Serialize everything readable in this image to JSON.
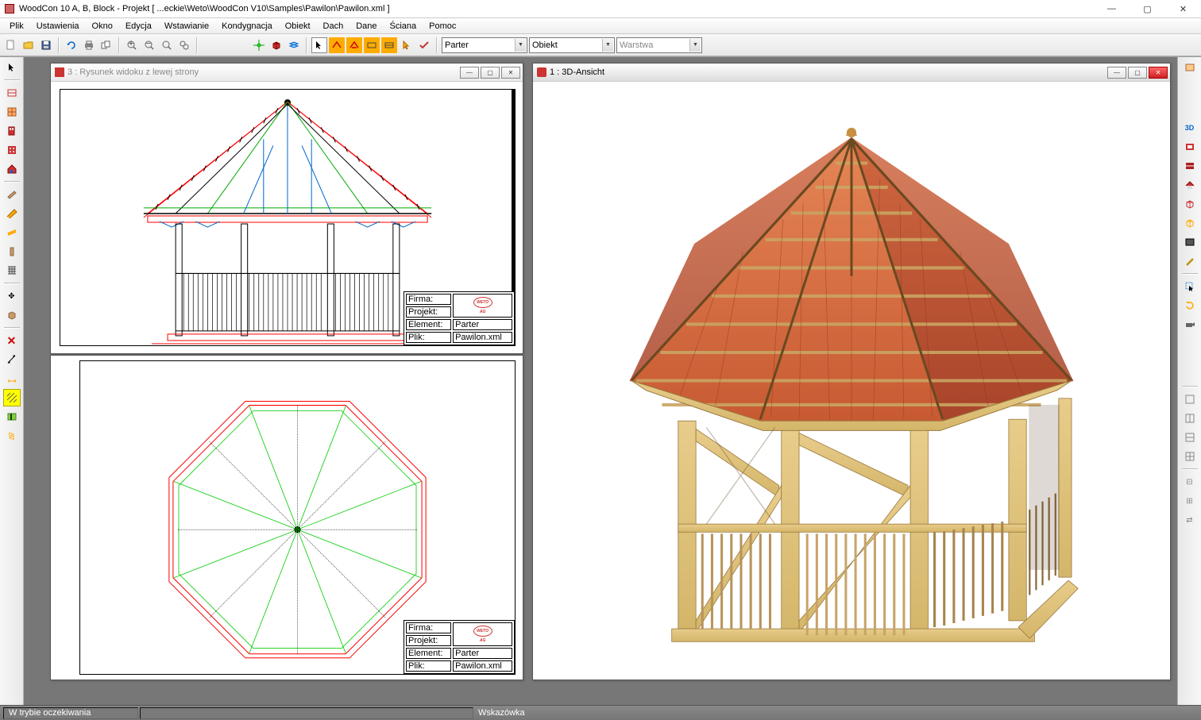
{
  "title": "WoodCon 10 A, B, Block - Projekt [ ...eckie\\Weto\\WoodCon V10\\Samples\\Pawilon\\Pawilon.xml ]",
  "menu": {
    "items": [
      "Plik",
      "Ustawienia",
      "Okno",
      "Edycja",
      "Wstawianie",
      "Kondygnacja",
      "Obiekt",
      "Dach",
      "Dane",
      "Ściana",
      "Pomoc"
    ]
  },
  "combos": {
    "floor": "Parter",
    "object": "Obiekt",
    "layer_placeholder": "Warstwa"
  },
  "panels": {
    "left_top": {
      "title": "3 : Rysunek widoku z lewej strony"
    },
    "right": {
      "title": "1 : 3D-Ansicht"
    }
  },
  "titleblock": {
    "firma": "Firma:",
    "projekt": "Projekt:",
    "element": "Element:",
    "element_val": "Parter",
    "plik": "Plik:",
    "plik_val": "Pawilon.xml",
    "logo": "WETO AG"
  },
  "status": {
    "mode": "W trybie oczekiwania",
    "hint": "Wskazówka"
  }
}
